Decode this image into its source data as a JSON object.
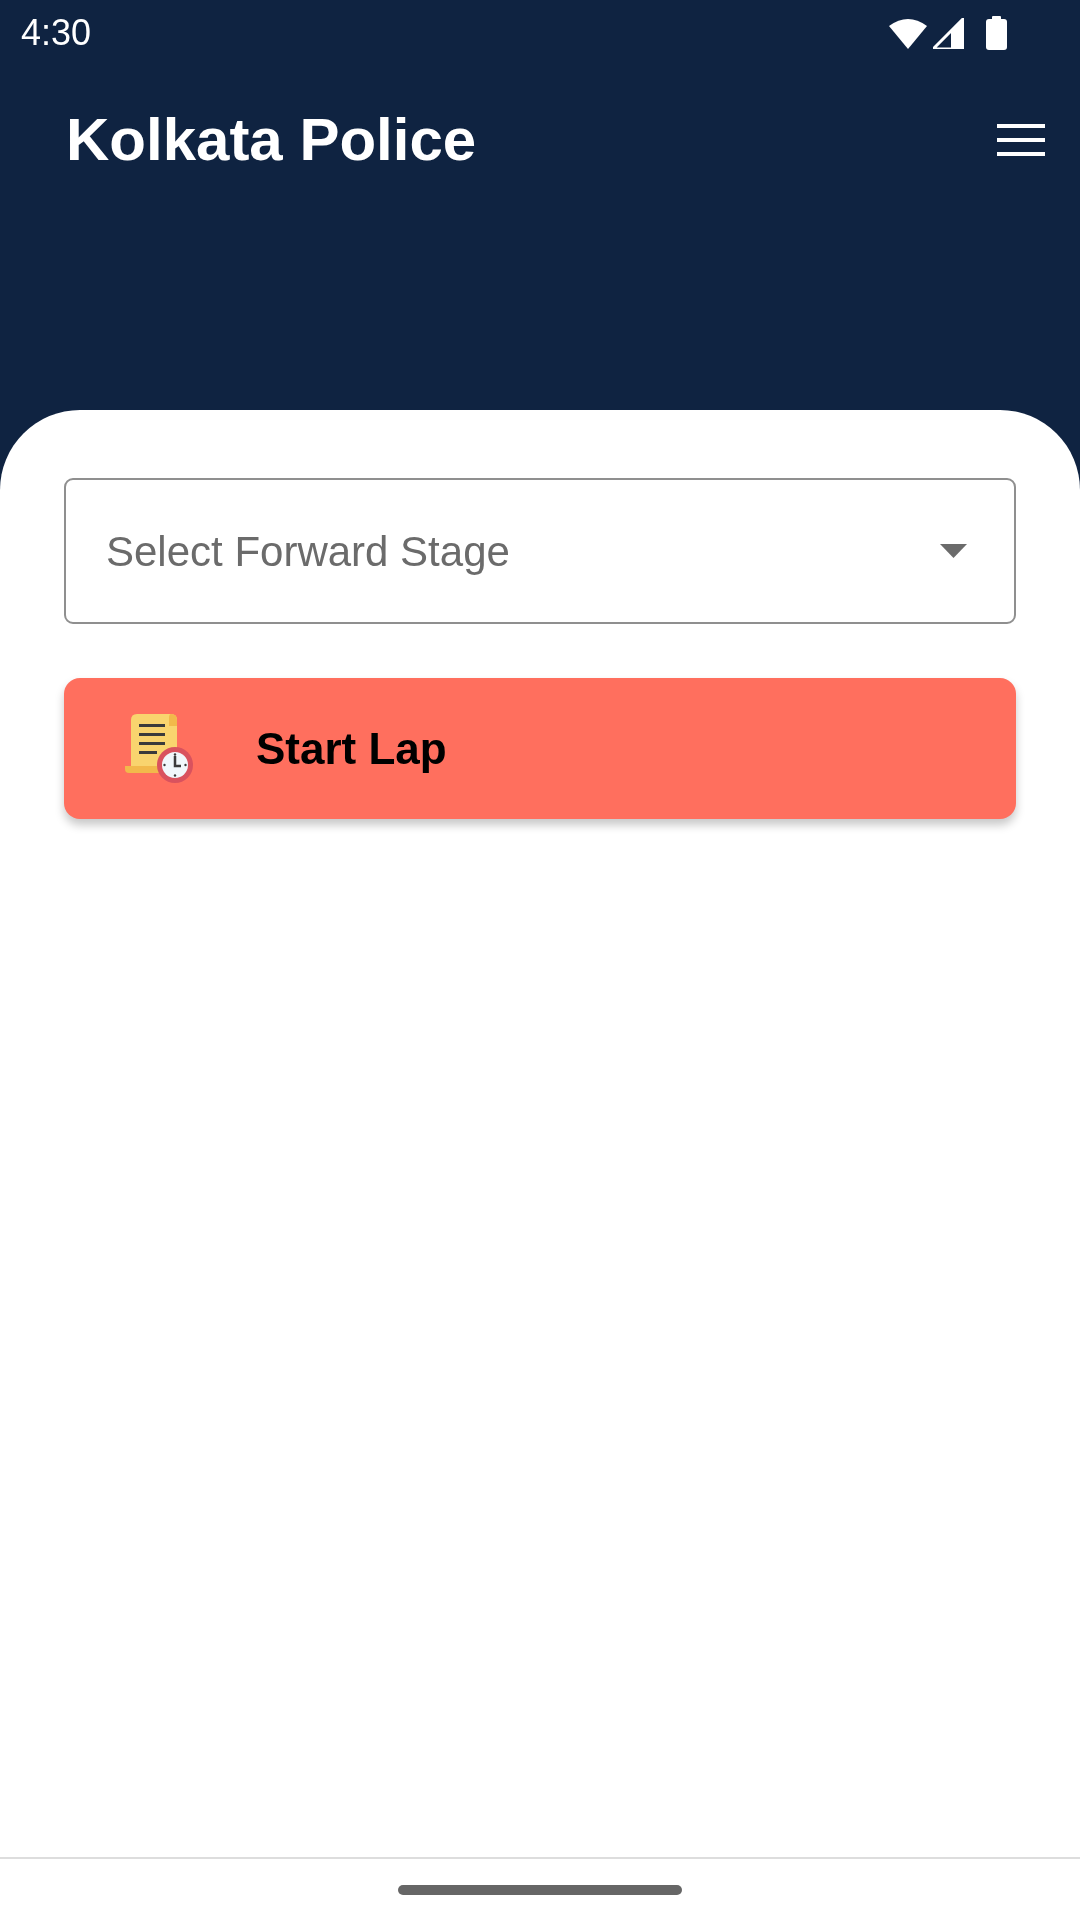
{
  "status_bar": {
    "time": "4:30"
  },
  "app_bar": {
    "title": "Kolkata Police"
  },
  "form": {
    "stage_dropdown": {
      "placeholder": "Select Forward Stage"
    },
    "start_button": {
      "label": "Start Lap"
    }
  }
}
